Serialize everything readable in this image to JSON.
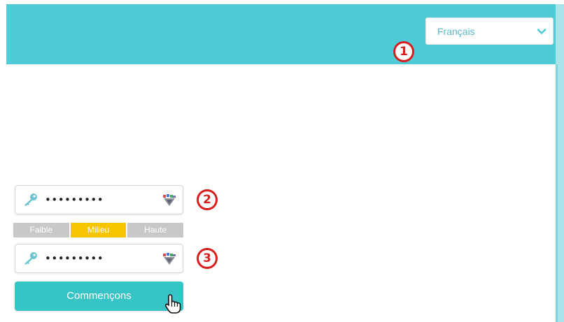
{
  "language_selector": {
    "value": "Français",
    "icon": "chevron-down-icon"
  },
  "markers": {
    "m1": "1",
    "m2": "2",
    "m3": "3"
  },
  "password_field": {
    "masked_value": "•••••••••",
    "key_icon": "key-icon",
    "reveal_icon": "reveal-password-icon"
  },
  "confirm_password_field": {
    "masked_value": "•••••••••",
    "key_icon": "key-icon",
    "reveal_icon": "reveal-password-icon"
  },
  "strength_meter": {
    "weak": "Faible",
    "medium": "Milieu",
    "high": "Haute",
    "active_level": "Milieu"
  },
  "start_button": {
    "label": "Commençons"
  },
  "colors": {
    "banner": "#4ecbd6",
    "accent": "#36c4c6",
    "marker": "#d91c1c",
    "strength_active": "#f7c400",
    "strength_inactive": "#c8c8c8"
  }
}
